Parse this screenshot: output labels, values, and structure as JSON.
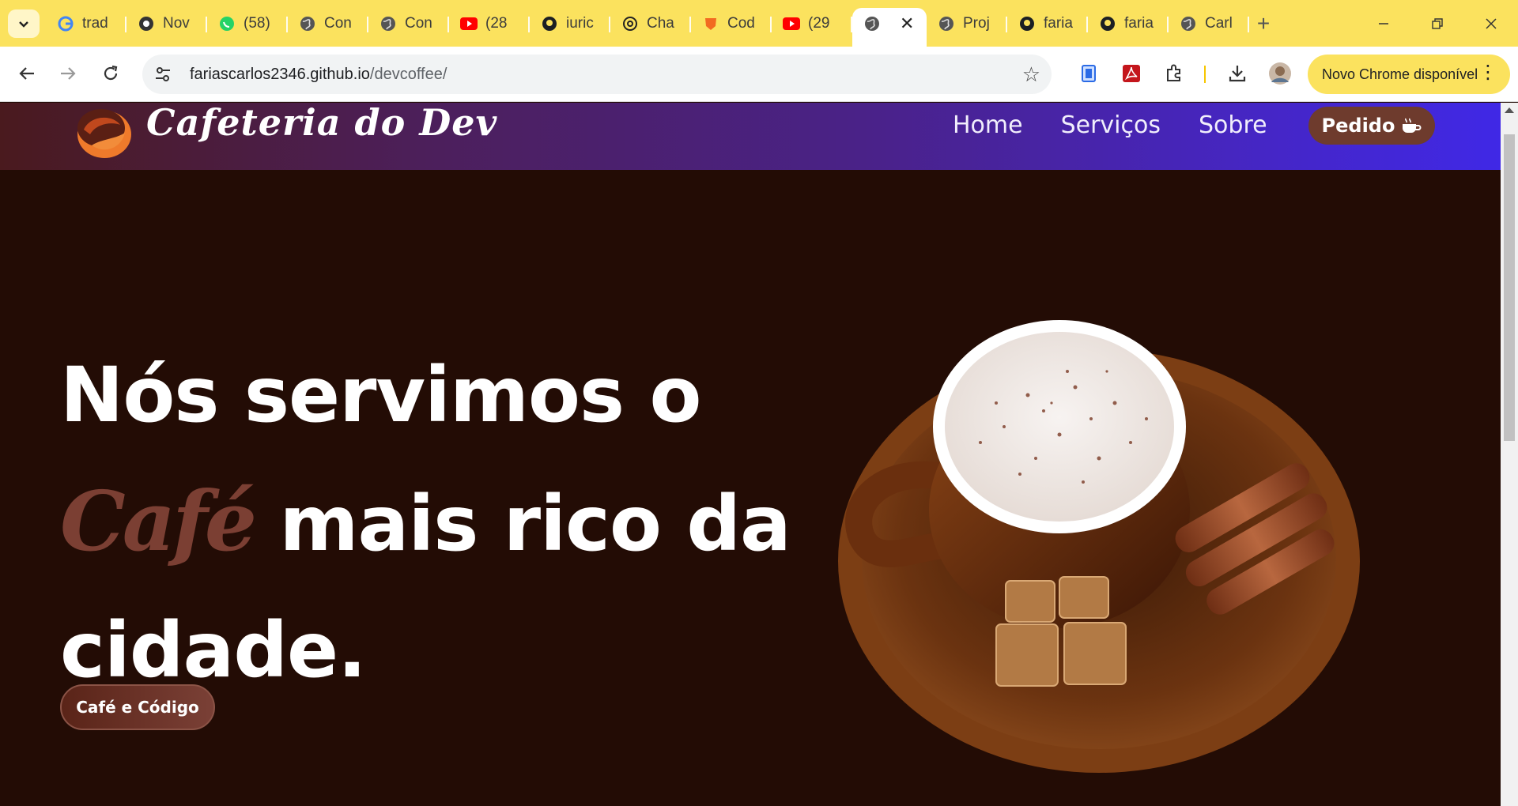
{
  "browser": {
    "tabs": [
      {
        "title": "trad",
        "icon": "google-icon"
      },
      {
        "title": "Nov",
        "icon": "chrome-icon"
      },
      {
        "title": "(58)",
        "icon": "whatsapp-icon"
      },
      {
        "title": "Con",
        "icon": "globe-icon"
      },
      {
        "title": "Con",
        "icon": "globe-icon"
      },
      {
        "title": "(28",
        "icon": "youtube-icon"
      },
      {
        "title": "iuric",
        "icon": "github-icon"
      },
      {
        "title": "Cha",
        "icon": "openai-icon"
      },
      {
        "title": "Cod",
        "icon": "brave-icon"
      },
      {
        "title": "(29",
        "icon": "youtube-icon"
      },
      {
        "title": "",
        "icon": "globe-icon",
        "active": true
      },
      {
        "title": "Proj",
        "icon": "globe-icon"
      },
      {
        "title": "faria",
        "icon": "github-icon"
      },
      {
        "title": "faria",
        "icon": "github-icon"
      },
      {
        "title": "Carl",
        "icon": "globe-icon"
      }
    ],
    "new_tab_label": "+",
    "close_tab_label": "✕",
    "url_host": "fariascarlos2346.github.io",
    "url_path": "/devcoffee/",
    "update_label": "Novo Chrome disponível",
    "colors": {
      "tabstrip": "#fbe25e",
      "toolbar": "#ffffff"
    }
  },
  "site": {
    "logo_text": "Cafeteria do Dev",
    "nav": [
      "Home",
      "Serviços",
      "Sobre"
    ],
    "order_button": "Pedido",
    "hero": {
      "line1": "Nós servimos o",
      "accent": "Café",
      "line2_rest": " mais rico da",
      "line3": "cidade.",
      "button": "Café e Código"
    },
    "colors": {
      "background": "#230c05",
      "accent": "#7b3f33",
      "button": "#6e3b2d"
    }
  }
}
